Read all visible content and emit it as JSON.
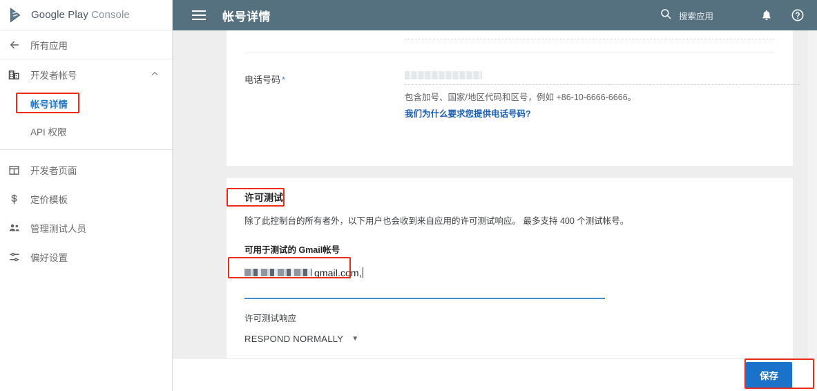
{
  "brand": {
    "name_bold": "Google Play",
    "name_light": "Console",
    "logo_icon": "google-play-icon"
  },
  "sidebar": {
    "back": {
      "label": "所有应用",
      "icon": "arrow-left-icon"
    },
    "developer_account": {
      "label": "开发者帐号",
      "icon": "building-icon",
      "chevron": "chevron-up-icon",
      "children": [
        {
          "label": "帐号详情",
          "active": true
        },
        {
          "label": "API 权限",
          "active": false
        }
      ]
    },
    "items": [
      {
        "label": "开发者页面",
        "icon": "page-icon"
      },
      {
        "label": "定价模板",
        "icon": "dollar-icon"
      },
      {
        "label": "管理测试人员",
        "icon": "people-icon"
      },
      {
        "label": "偏好设置",
        "icon": "tune-icon"
      }
    ]
  },
  "topbar": {
    "menu_icon": "hamburger-icon",
    "title": "帐号详情",
    "search_icon": "search-icon",
    "search_label": "搜索应用",
    "notification_icon": "bell-icon",
    "help_icon": "help-circle-icon",
    "bg_color": "#55707e"
  },
  "phone_section": {
    "label": "电话号码",
    "required_mark": "*",
    "value_redacted": "",
    "helper": "包含加号、国家/地区代码和区号，例如 +86-10-6666-6666。",
    "link": "我们为什么要求您提供电话号码?"
  },
  "license_section": {
    "title": "许可测试",
    "description": "除了此控制台的所有者外，以下用户也会收到来自应用的许可测试响应。 最多支持 400 个测试帐号。",
    "gmail_label": "可用于测试的 Gmail帐号",
    "gmail_value": "gmail.com,",
    "response_label": "许可测试响应",
    "response_value": "RESPOND NORMALLY",
    "response_arrow": "chevron-down-icon"
  },
  "footer": {
    "save_label": "保存",
    "save_color": "#1a73c9"
  },
  "annotations": {
    "color": "#ef2b18",
    "boxes": [
      "sidebar-account-details",
      "license-test-title",
      "gmail-account-input",
      "save-button"
    ]
  }
}
